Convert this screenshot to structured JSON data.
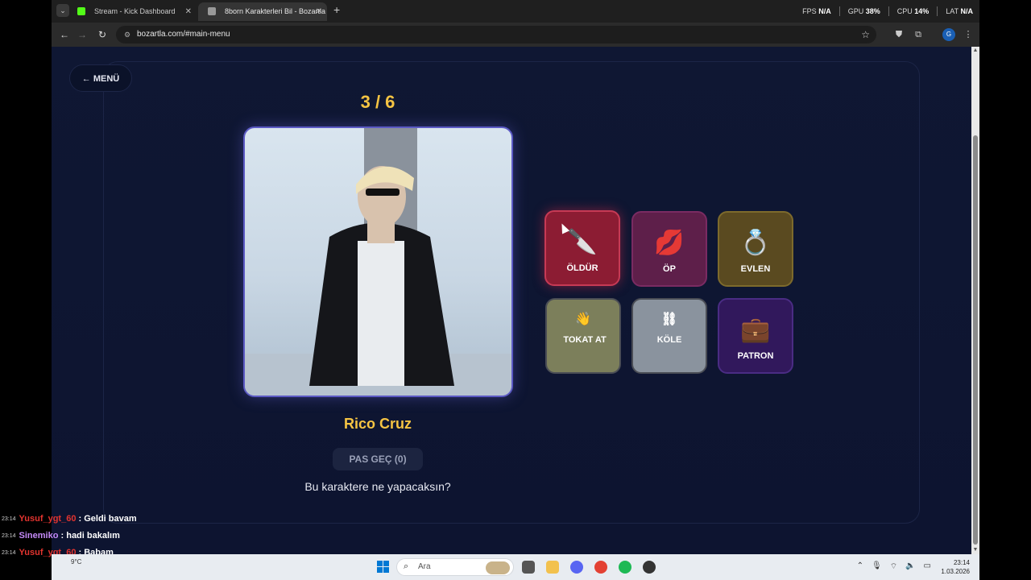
{
  "browser": {
    "tabs": [
      {
        "title": "Stream - Kick Dashboard",
        "active": false
      },
      {
        "title": "8born Karakterleri Bil - Bozartla",
        "active": true
      }
    ],
    "new_tab": "+",
    "url": "bozartla.com/#main-menu",
    "profile_initial": "G",
    "perf": {
      "fps_label": "FPS",
      "fps_value": "N/A",
      "gpu_label": "GPU",
      "gpu_value": "38%",
      "cpu_label": "CPU",
      "cpu_value": "14%",
      "lat_label": "LAT",
      "lat_value": "N/A"
    }
  },
  "game": {
    "menu_button": "← MENÜ",
    "progress": "3 / 6",
    "character_name": "Rico Cruz",
    "skip_button": "PAS GEÇ (0)",
    "question": "Bu karaktere ne yapacaksın?",
    "actions": [
      {
        "label": "ÖLDÜR",
        "icon": "knife-icon",
        "emoji": "🔪",
        "color": "#8c1c33"
      },
      {
        "label": "ÖP",
        "icon": "lips-icon",
        "emoji": "💋",
        "color": "#5e1f4a"
      },
      {
        "label": "EVLEN",
        "icon": "ring-icon",
        "emoji": "💍",
        "color": "#5a4a20"
      },
      {
        "label": "TOKAT AT",
        "icon": "hand-icon",
        "emoji": "👋",
        "color": "#7c7f5b"
      },
      {
        "label": "KÖLE",
        "icon": "chain-icon",
        "emoji": "⛓",
        "color": "#8a939e"
      },
      {
        "label": "PATRON",
        "icon": "briefcase-icon",
        "emoji": "💼",
        "color": "#31185c"
      }
    ]
  },
  "chat": [
    {
      "time": "23:14",
      "user": "Yusuf_ygt_60",
      "user_color": "#e3342f",
      "message": ": Geldi bavam"
    },
    {
      "time": "23:14",
      "user": "Sinemiko",
      "user_color": "#c58af9",
      "message": ": hadi bakalım"
    },
    {
      "time": "23:14",
      "user": "Yusuf_ygt_60",
      "user_color": "#e3342f",
      "message": ": Babam"
    }
  ],
  "taskbar": {
    "search_placeholder": "Ara",
    "weather": "9°C",
    "time": "23:14",
    "date": "1.03.2026"
  }
}
